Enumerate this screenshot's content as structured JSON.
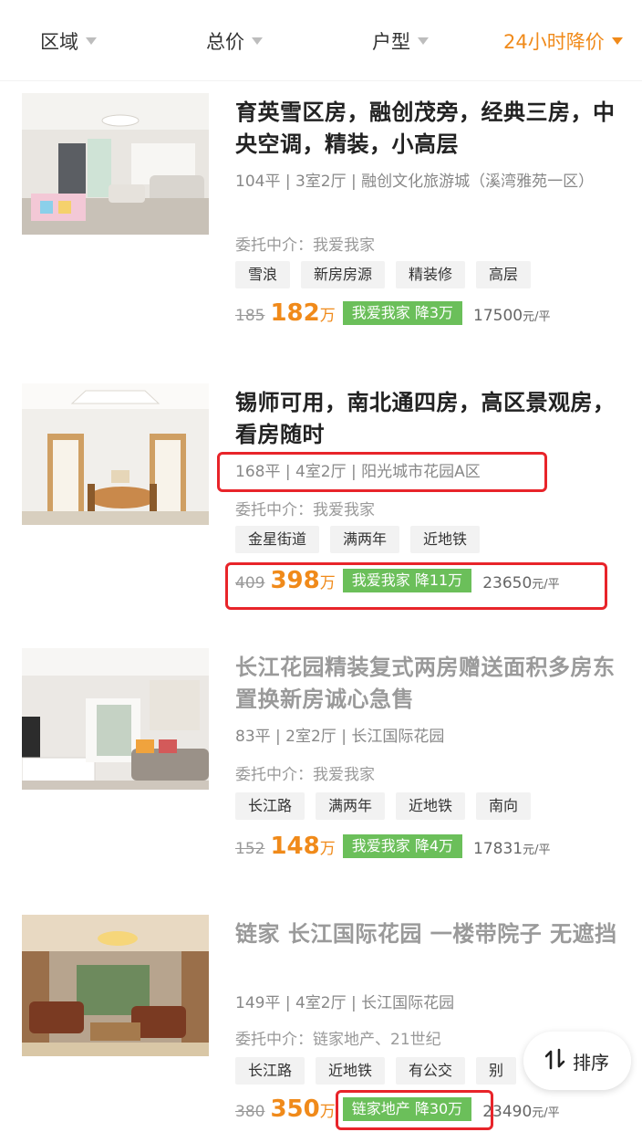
{
  "filters": [
    {
      "label": "区域"
    },
    {
      "label": "总价"
    },
    {
      "label": "户型"
    },
    {
      "label": "24小时降价"
    }
  ],
  "listings": [
    {
      "title": "育英雪区房，融创茂旁，经典三房，中央空调，精装，小高层",
      "meta": "104平 | 3室2厅 | 融创文化旅游城（溪湾雅苑一区）",
      "agent": "委托中介：我爱我家",
      "tags": [
        "雪浪",
        "新房房源",
        "精装修",
        "高层"
      ],
      "old_price": "185",
      "new_price": "182",
      "price_unit": "万",
      "cut": "我爱我家 降3万",
      "unit_price": "17500",
      "unit_price_suffix": "元/平",
      "viewed": false
    },
    {
      "title": "锡师可用，南北通四房，高区景观房，看房随时",
      "meta": "168平 | 4室2厅 | 阳光城市花园A区",
      "agent": "委托中介：我爱我家",
      "tags": [
        "金星街道",
        "满两年",
        "近地铁"
      ],
      "old_price": "409",
      "new_price": "398",
      "price_unit": "万",
      "cut": "我爱我家 降11万",
      "unit_price": "23650",
      "unit_price_suffix": "元/平",
      "viewed": false
    },
    {
      "title": "长江花园精装复式两房赠送面积多房东置换新房诚心急售",
      "meta": "83平 | 2室2厅 | 长江国际花园",
      "agent": "委托中介：我爱我家",
      "tags": [
        "长江路",
        "满两年",
        "近地铁",
        "南向"
      ],
      "old_price": "152",
      "new_price": "148",
      "price_unit": "万",
      "cut": "我爱我家 降4万",
      "unit_price": "17831",
      "unit_price_suffix": "元/平",
      "viewed": true
    },
    {
      "title": "链家 长江国际花园 一楼带院子 无遮挡",
      "meta": "149平 | 4室2厅 | 长江国际花园",
      "agent": "委托中介：链家地产、21世纪",
      "tags": [
        "长江路",
        "近地铁",
        "有公交",
        "别"
      ],
      "old_price": "380",
      "new_price": "350",
      "price_unit": "万",
      "cut": "链家地产 降30万",
      "unit_price": "23490",
      "unit_price_suffix": "元/平",
      "viewed": true
    }
  ],
  "sort_button": {
    "label": "排序",
    "icon": "sort-arrows-icon"
  },
  "colors": {
    "accent": "#f08a1a",
    "cut_badge": "#6bbf5a",
    "highlight": "#e8242a"
  }
}
